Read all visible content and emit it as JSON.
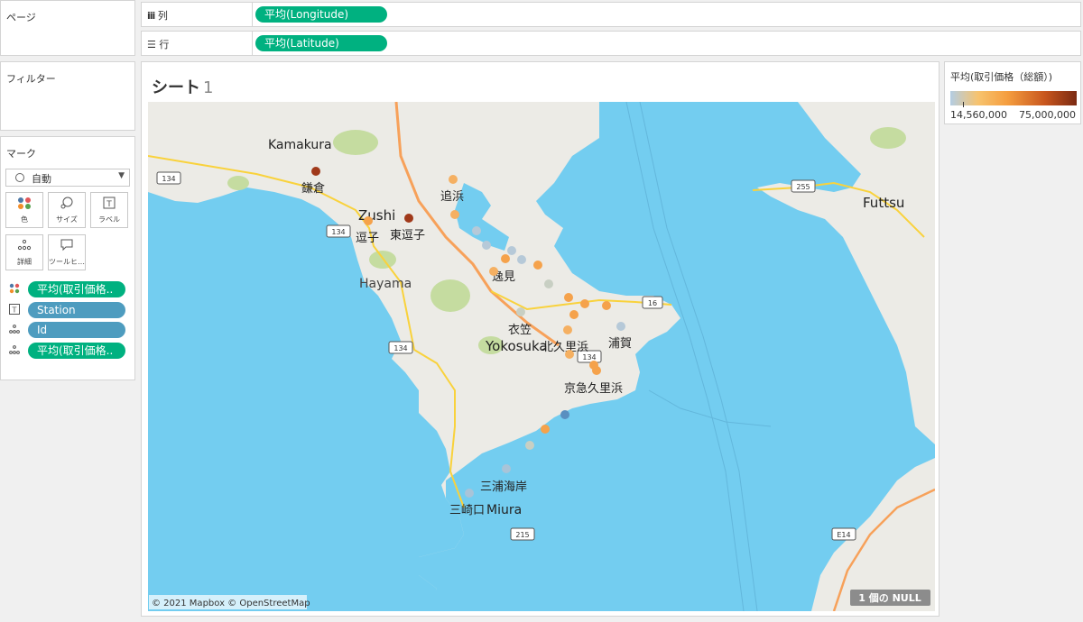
{
  "pages_panel": {
    "title": "ページ"
  },
  "filters_panel": {
    "title": "フィルター"
  },
  "columns_shelf": {
    "label": "列",
    "pill": "平均(Longitude)"
  },
  "rows_shelf": {
    "label": "行",
    "pill": "平均(Latitude)"
  },
  "marks_panel": {
    "title": "マーク",
    "mark_type": "自動",
    "buttons": [
      {
        "label": "色",
        "icon": "color-dots-icon"
      },
      {
        "label": "サイズ",
        "icon": "size-icon"
      },
      {
        "label": "ラベル",
        "icon": "label-icon"
      },
      {
        "label": "詳細",
        "icon": "detail-icon"
      },
      {
        "label": "ツールヒ…",
        "icon": "tooltip-icon"
      }
    ],
    "encodings": [
      {
        "icon": "color-dots-icon",
        "pill": "平均(取引価格..",
        "color": "green"
      },
      {
        "icon": "label-icon",
        "pill": "Station",
        "color": "blue"
      },
      {
        "icon": "detail-icon",
        "pill": "Id",
        "color": "blue"
      },
      {
        "icon": "detail-icon",
        "pill": "平均(取引価格..",
        "color": "green"
      }
    ]
  },
  "sheet": {
    "title": "シート",
    "number": "1"
  },
  "legend": {
    "title": "平均(取引価格（総額）)",
    "min": "14,560,000",
    "max": "75,000,000",
    "colors": [
      "#b3cde3",
      "#f7c36e",
      "#f59e3f",
      "#c8561e",
      "#7a2a12"
    ]
  },
  "map": {
    "attribution": "© 2021 Mapbox © OpenStreetMap",
    "null_badge": "1 個の NULL",
    "colors": {
      "sea": "#73cdf0",
      "land": "#ecebe6",
      "green": "#c5dca0",
      "road": "#f9d23c",
      "highway": "#f7a15a"
    },
    "place_labels": [
      "Kamakura",
      "鎌倉",
      "Zushi",
      "逗子",
      "東逗子",
      "追浜",
      "Hayama",
      "逸見",
      "衣笠",
      "Yokosuka",
      "北久里浜",
      "浦賀",
      "京急久里浜",
      "三浦海岸",
      "三崎口",
      "Miura",
      "Futtsu"
    ],
    "road_shields": [
      "134",
      "134",
      "134",
      "16",
      "134",
      "255",
      "215",
      "E14"
    ]
  }
}
